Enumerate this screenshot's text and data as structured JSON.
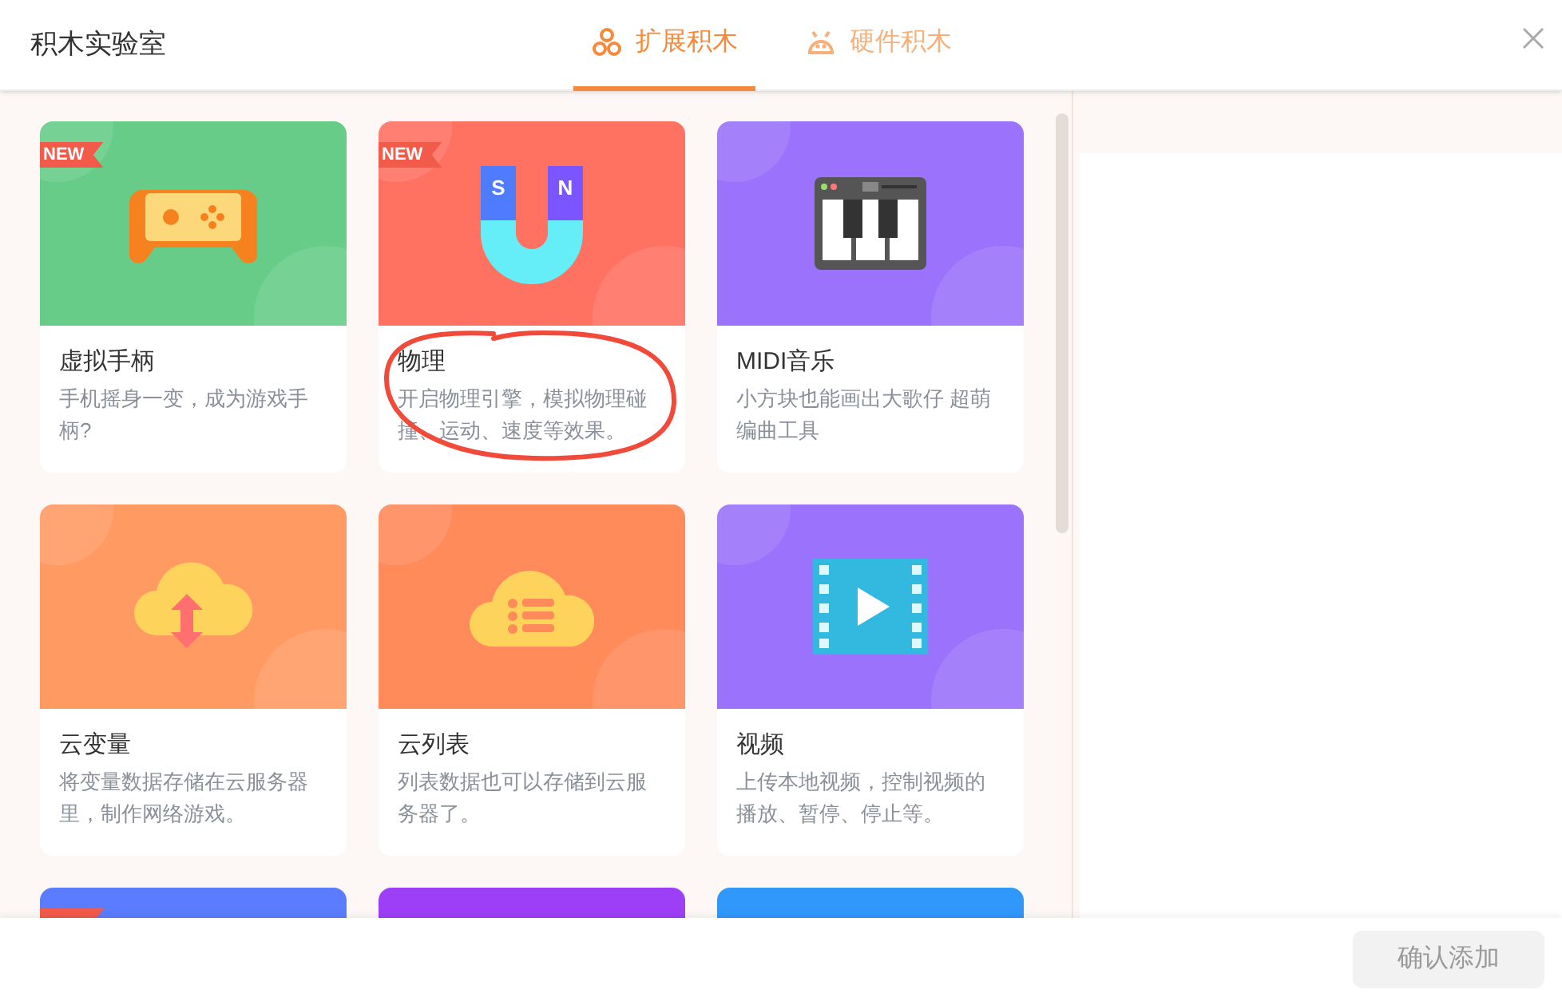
{
  "window": {
    "title": "积木实验室"
  },
  "tabs": [
    {
      "label": "扩展积木",
      "kind": "hexagons",
      "selected": true
    },
    {
      "label": "硬件积木",
      "kind": "robot",
      "selected": false
    }
  ],
  "cards": [
    {
      "title": "虚拟手柄",
      "description": "手机摇身一变，成为游戏手柄?",
      "badge": "NEW",
      "kind": "gamepad",
      "color": "#66cc88"
    },
    {
      "title": "物理",
      "description": "开启物理引擎，模拟物理碰撞、运动、速度等效果。",
      "badge": "NEW",
      "kind": "magnet",
      "icon_labels": [
        "S",
        "N"
      ],
      "color": "#ff7262"
    },
    {
      "title": "MIDI音乐",
      "description": "小方块也能画出大歌仔 超萌编曲工具",
      "kind": "piano",
      "color": "#9b72fb"
    },
    {
      "title": "云变量",
      "description": "将变量数据存储在云服务器里，制作网络游戏。",
      "kind": "cloud-arrows",
      "color": "#ff9a62"
    },
    {
      "title": "云列表",
      "description": "列表数据也可以存储到云服务器了。",
      "kind": "cloud-list",
      "color": "#ff8a5a"
    },
    {
      "title": "视频",
      "description": "上传本地视频，控制视频的播放、暂停、停止等。",
      "kind": "film",
      "color": "#9b72fb"
    },
    {
      "new": true,
      "color": "#5b7cff"
    },
    {
      "new": false,
      "color": "#9d3ff7"
    },
    {
      "new": false,
      "color": "#3097fb"
    }
  ],
  "confirm_button": {
    "label": "确认添加",
    "disabled": true
  }
}
